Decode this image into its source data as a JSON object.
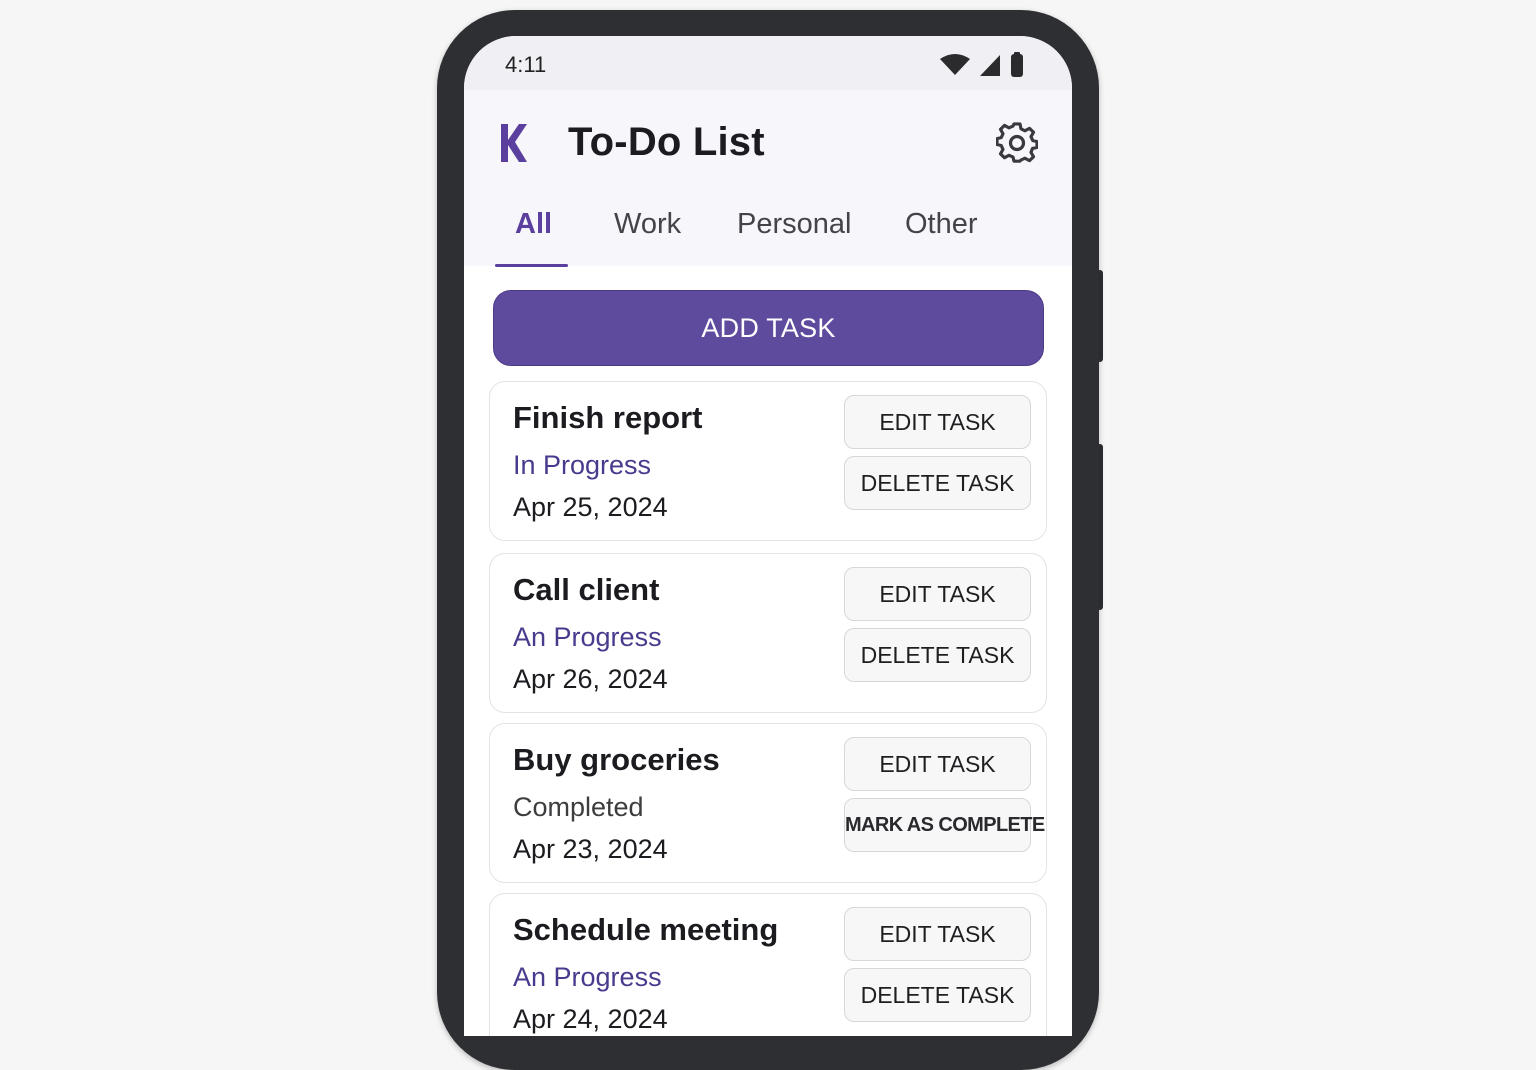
{
  "status_bar": {
    "time": "4:11"
  },
  "header": {
    "title": "To-Do List",
    "logo_icon": "k-logo-icon",
    "settings_icon": "gear-icon"
  },
  "tabs": [
    {
      "label": "All",
      "active": true
    },
    {
      "label": "Work",
      "active": false
    },
    {
      "label": "Personal",
      "active": false
    },
    {
      "label": "Other",
      "active": false
    }
  ],
  "add_button_label": "ADD TASK",
  "tasks": [
    {
      "title": "Finish report",
      "status": "In Progress",
      "date": "Apr 25, 2024",
      "primary_action": "EDIT TASK",
      "secondary_action": "DELETE TASK"
    },
    {
      "title": "Call client",
      "status": "An Progress",
      "date": "Apr 26, 2024",
      "primary_action": "EDIT TASK",
      "secondary_action": "DELETE TASK"
    },
    {
      "title": "Buy groceries",
      "status": "Completed",
      "date": "Apr 23, 2024",
      "primary_action": "EDIT TASK",
      "secondary_action": "MARK AS COMPLETE"
    },
    {
      "title": "Schedule meeting",
      "status": "An Progress",
      "date": "Apr 24, 2024",
      "primary_action": "EDIT TASK",
      "secondary_action": "DELETE TASK"
    }
  ],
  "colors": {
    "accent": "#5f4b9e",
    "status_in_progress": "#4a3a8e"
  }
}
